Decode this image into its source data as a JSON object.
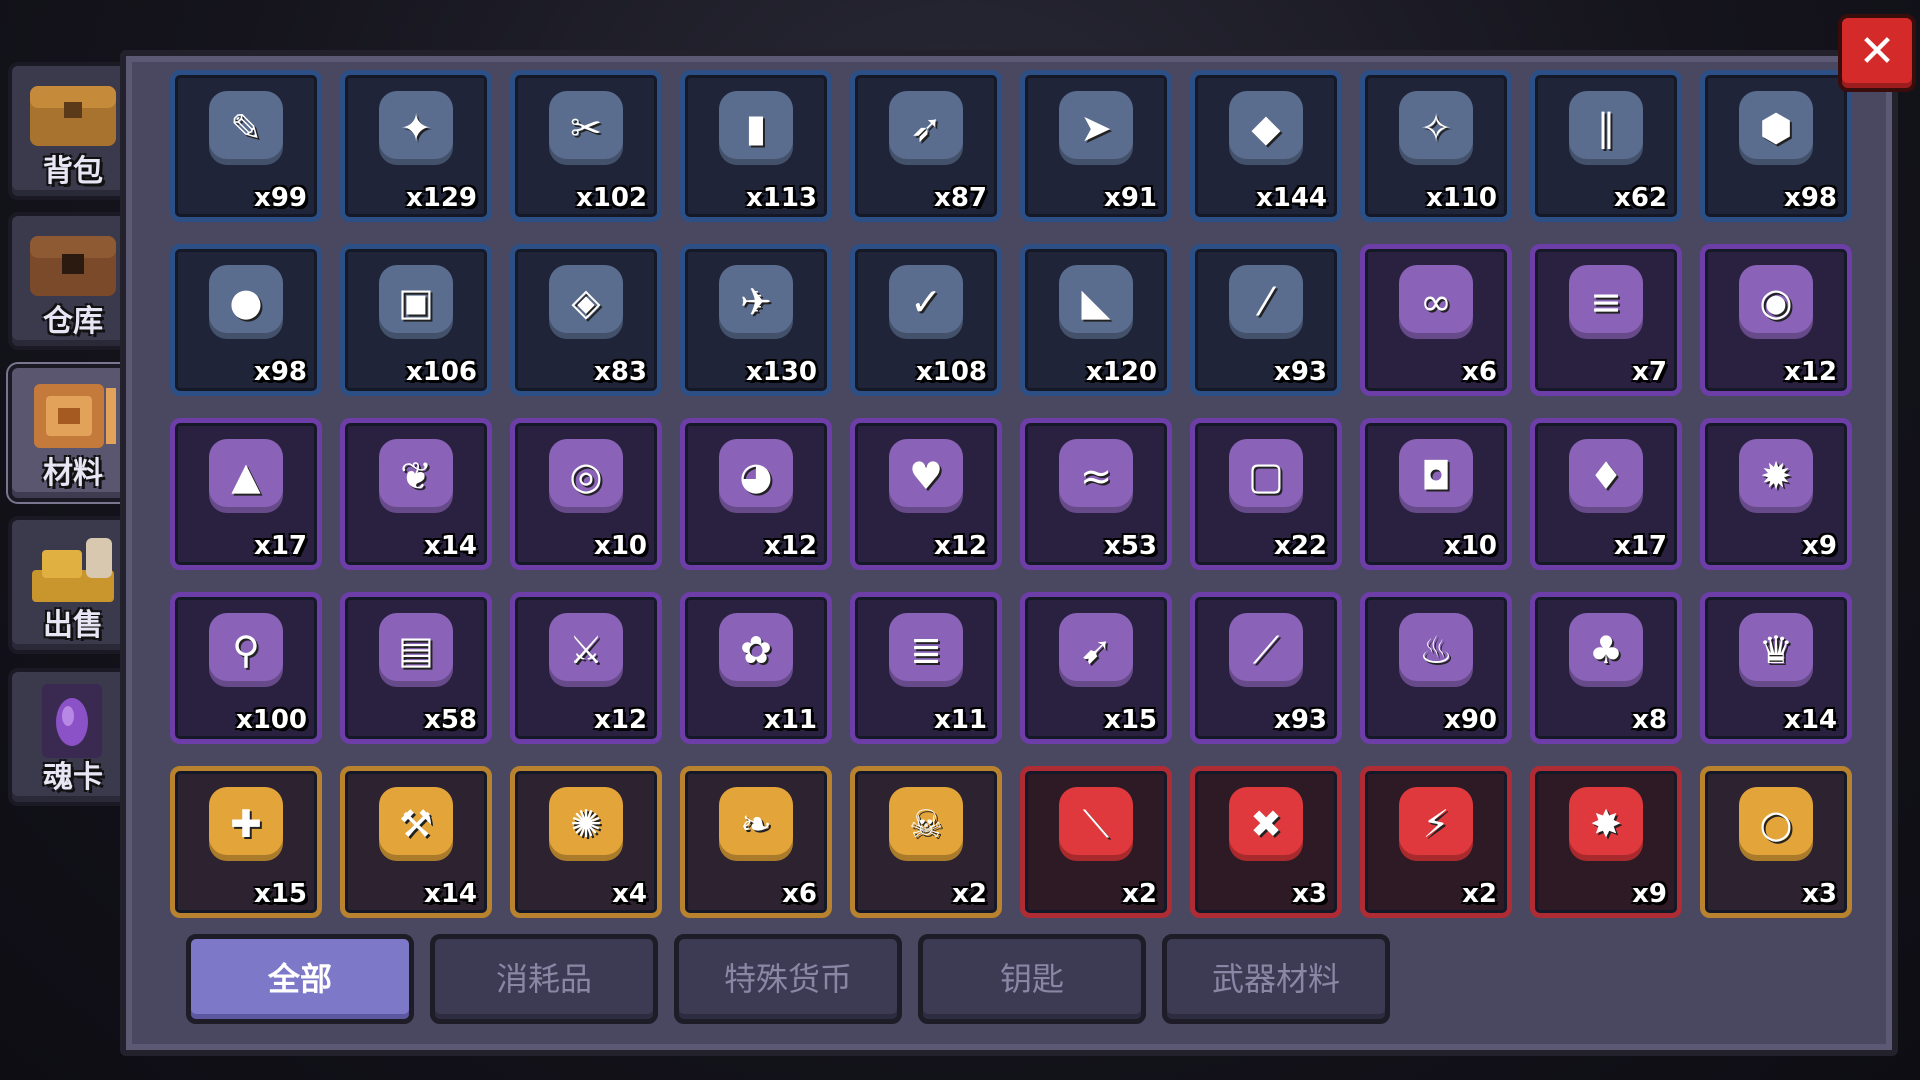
{
  "sidebar": {
    "tabs": [
      {
        "label": "背包",
        "icon": "chest-icon",
        "active": false
      },
      {
        "label": "仓库",
        "icon": "storage-chest-icon",
        "active": false
      },
      {
        "label": "材料",
        "icon": "materials-icon",
        "active": true
      },
      {
        "label": "出售",
        "icon": "gold-pile-icon",
        "active": false
      },
      {
        "label": "魂卡",
        "icon": "soul-card-icon",
        "active": false
      }
    ]
  },
  "close_button": {
    "glyph": "✕"
  },
  "items": [
    {
      "count": "x99",
      "rarity": "blue",
      "glyph": "✎",
      "icon": "spear-icon"
    },
    {
      "count": "x129",
      "rarity": "blue",
      "glyph": "✦",
      "icon": "rifle-icon"
    },
    {
      "count": "x102",
      "rarity": "blue",
      "glyph": "✂",
      "icon": "red-blade-icon"
    },
    {
      "count": "x113",
      "rarity": "blue",
      "glyph": "▮",
      "icon": "barrel-icon"
    },
    {
      "count": "x87",
      "rarity": "blue",
      "glyph": "➶",
      "icon": "shotgun-icon"
    },
    {
      "count": "x91",
      "rarity": "blue",
      "glyph": "➤",
      "icon": "golden-bullet-icon"
    },
    {
      "count": "x144",
      "rarity": "blue",
      "glyph": "◆",
      "icon": "red-spike-icon"
    },
    {
      "count": "x110",
      "rarity": "blue",
      "glyph": "✧",
      "icon": "purple-fish-icon"
    },
    {
      "count": "x62",
      "rarity": "blue",
      "glyph": "∥",
      "icon": "tube-icon"
    },
    {
      "count": "x98",
      "rarity": "blue",
      "glyph": "⬢",
      "icon": "orange-gem-icon"
    },
    {
      "count": "x98",
      "rarity": "blue",
      "glyph": "●",
      "icon": "white-blob-icon"
    },
    {
      "count": "x106",
      "rarity": "blue",
      "glyph": "▣",
      "icon": "lantern-icon"
    },
    {
      "count": "x83",
      "rarity": "blue",
      "glyph": "◈",
      "icon": "plank-icon"
    },
    {
      "count": "x130",
      "rarity": "blue",
      "glyph": "✈",
      "icon": "blue-pistol-icon"
    },
    {
      "count": "x108",
      "rarity": "blue",
      "glyph": "✓",
      "icon": "green-blade-icon"
    },
    {
      "count": "x120",
      "rarity": "blue",
      "glyph": "◣",
      "icon": "boomerang-icon"
    },
    {
      "count": "x93",
      "rarity": "blue",
      "glyph": "⁄",
      "icon": "wooden-stick-icon"
    },
    {
      "count": "x6",
      "rarity": "purple",
      "glyph": "∞",
      "icon": "goggles-icon"
    },
    {
      "count": "x7",
      "rarity": "purple",
      "glyph": "≡",
      "icon": "laser-gun-icon"
    },
    {
      "count": "x12",
      "rarity": "purple",
      "glyph": "◉",
      "icon": "stone-ring-icon"
    },
    {
      "count": "x17",
      "rarity": "purple",
      "glyph": "▲",
      "icon": "bell-icon"
    },
    {
      "count": "x14",
      "rarity": "purple",
      "glyph": "❦",
      "icon": "trophy-icon"
    },
    {
      "count": "x10",
      "rarity": "purple",
      "glyph": "◎",
      "icon": "orange-ring-icon"
    },
    {
      "count": "x12",
      "rarity": "purple",
      "glyph": "◕",
      "icon": "green-eye-icon"
    },
    {
      "count": "x12",
      "rarity": "purple",
      "glyph": "♥",
      "icon": "red-necklace-icon"
    },
    {
      "count": "x53",
      "rarity": "purple",
      "glyph": "≈",
      "icon": "horn-icon"
    },
    {
      "count": "x22",
      "rarity": "purple",
      "glyph": "▢",
      "icon": "shield-badge-icon"
    },
    {
      "count": "x10",
      "rarity": "purple",
      "glyph": "◘",
      "icon": "battery-icon"
    },
    {
      "count": "x17",
      "rarity": "purple",
      "glyph": "♦",
      "icon": "pink-crystal-icon"
    },
    {
      "count": "x9",
      "rarity": "purple",
      "glyph": "✹",
      "icon": "red-orb-icon"
    },
    {
      "count": "x100",
      "rarity": "purple",
      "glyph": "⚲",
      "icon": "ice-cream-icon"
    },
    {
      "count": "x58",
      "rarity": "purple",
      "glyph": "▤",
      "icon": "armor-icon"
    },
    {
      "count": "x12",
      "rarity": "purple",
      "glyph": "⚔",
      "icon": "ice-sword-icon"
    },
    {
      "count": "x11",
      "rarity": "purple",
      "glyph": "✿",
      "icon": "pink-flower-icon"
    },
    {
      "count": "x11",
      "rarity": "purple",
      "glyph": "≣",
      "icon": "green-rifle-icon"
    },
    {
      "count": "x15",
      "rarity": "purple",
      "glyph": "➹",
      "icon": "brown-gun-icon"
    },
    {
      "count": "x93",
      "rarity": "purple",
      "glyph": "⟋",
      "icon": "blue-rod-icon"
    },
    {
      "count": "x90",
      "rarity": "purple",
      "glyph": "♨",
      "icon": "red-lantern-icon"
    },
    {
      "count": "x8",
      "rarity": "purple",
      "glyph": "♣",
      "icon": "cactus-icon"
    },
    {
      "count": "x14",
      "rarity": "purple",
      "glyph": "♛",
      "icon": "crown-icon"
    },
    {
      "count": "x15",
      "rarity": "gold",
      "glyph": "✚",
      "icon": "compass-icon"
    },
    {
      "count": "x14",
      "rarity": "gold",
      "glyph": "⚒",
      "icon": "pickaxe-icon"
    },
    {
      "count": "x4",
      "rarity": "gold",
      "glyph": "✺",
      "icon": "sun-flower-icon"
    },
    {
      "count": "x6",
      "rarity": "gold",
      "glyph": "❧",
      "icon": "green-leaf-icon"
    },
    {
      "count": "x2",
      "rarity": "gold",
      "glyph": "☠",
      "icon": "ghost-skull-icon"
    },
    {
      "count": "x2",
      "rarity": "red",
      "glyph": "⟍",
      "icon": "purple-sword-icon"
    },
    {
      "count": "x3",
      "rarity": "red",
      "glyph": "✖",
      "icon": "crossed-weapons-icon"
    },
    {
      "count": "x2",
      "rarity": "red",
      "glyph": "⚡",
      "icon": "cyan-blade-icon"
    },
    {
      "count": "x9",
      "rarity": "red",
      "glyph": "✸",
      "icon": "fire-core-icon"
    },
    {
      "count": "x3",
      "rarity": "gold",
      "glyph": "○",
      "icon": "white-moon-icon"
    }
  ],
  "filters": {
    "tabs": [
      {
        "label": "全部",
        "active": true
      },
      {
        "label": "消耗品",
        "active": false
      },
      {
        "label": "特殊货币",
        "active": false
      },
      {
        "label": "钥匙",
        "active": false
      },
      {
        "label": "武器材料",
        "active": false
      }
    ]
  }
}
